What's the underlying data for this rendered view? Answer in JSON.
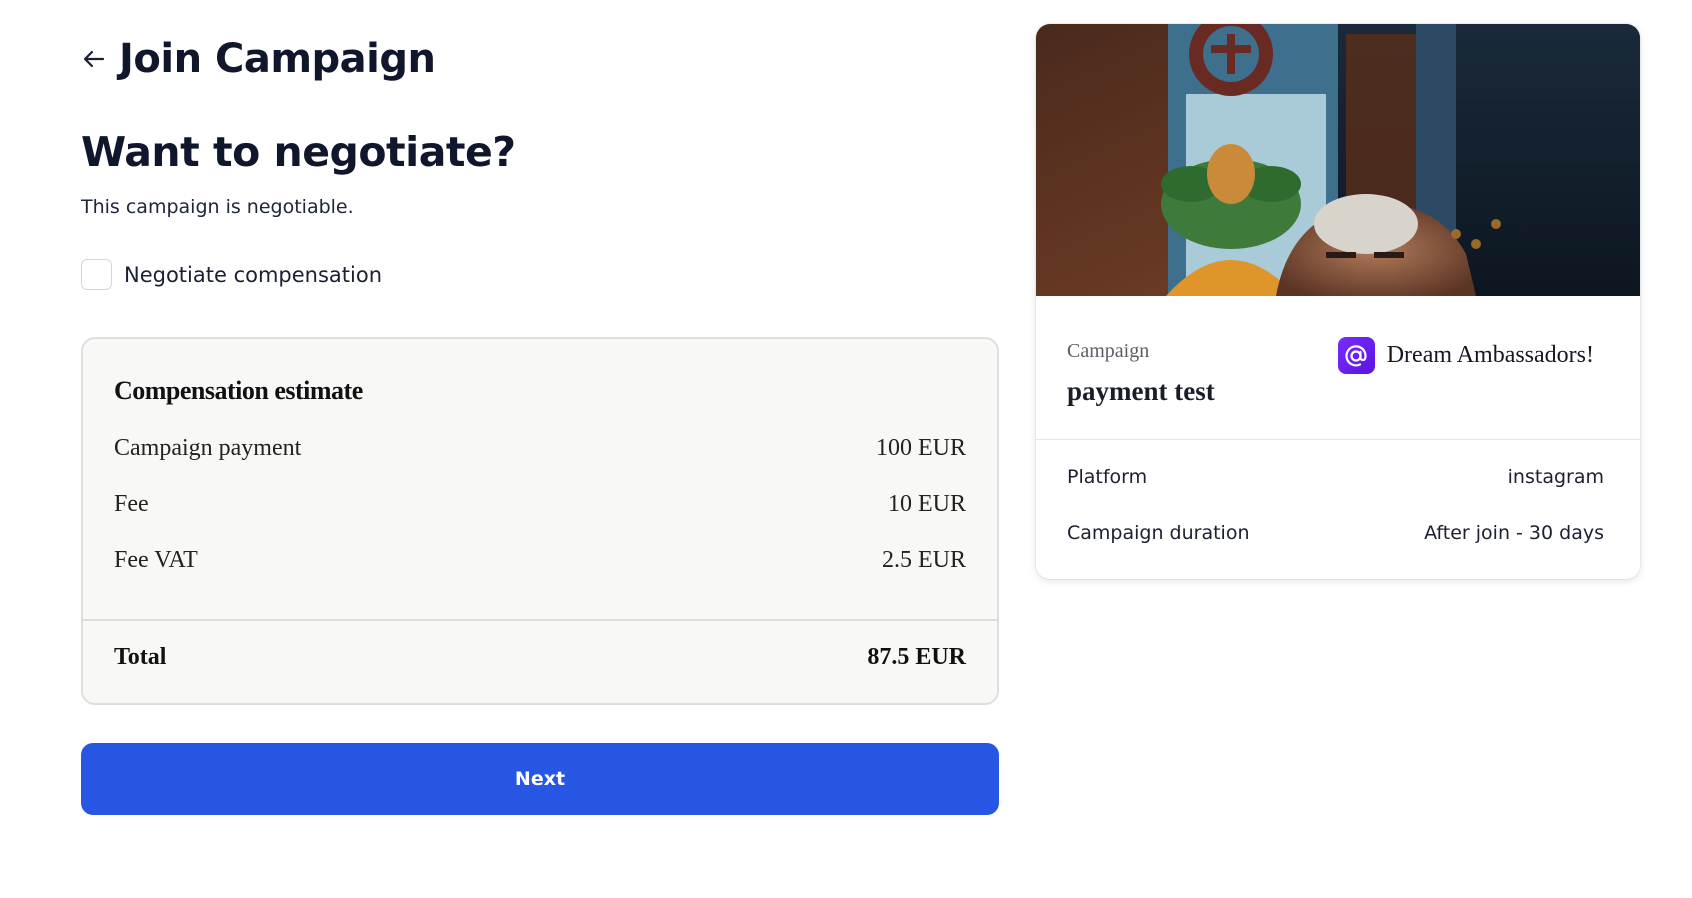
{
  "header": {
    "title": "Join Campaign",
    "back_icon": "arrow-left-icon"
  },
  "negotiate": {
    "title": "Want to negotiate?",
    "subtitle": "This campaign is negotiable.",
    "checkbox_label": "Negotiate compensation",
    "checked": false
  },
  "compensation": {
    "title": "Compensation estimate",
    "rows": [
      {
        "label": "Campaign payment",
        "value": "100 EUR"
      },
      {
        "label": "Fee",
        "value": "10 EUR"
      },
      {
        "label": "Fee VAT",
        "value": "2.5 EUR"
      }
    ],
    "total_label": "Total",
    "total_value": "87.5 EUR"
  },
  "next_button": {
    "label": "Next",
    "color": "#2756e4"
  },
  "campaign_card": {
    "campaign_label": "Campaign",
    "campaign_name": "payment test",
    "brand_name": "Dream Ambassadors!",
    "brand_icon": "at-sign-icon",
    "brand_color": "#6a1df0",
    "info": [
      {
        "label": "Platform",
        "value": "instagram"
      },
      {
        "label": "Campaign duration",
        "value": "After join - 30 days"
      }
    ]
  }
}
